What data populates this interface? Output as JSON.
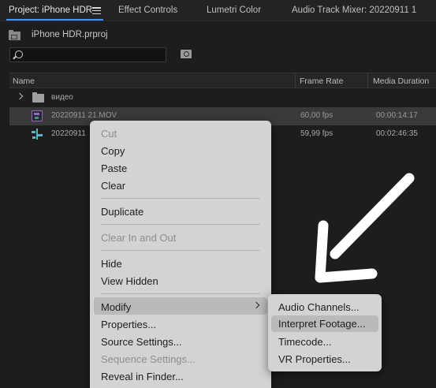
{
  "tabs": {
    "project": "Project: iPhone HDR",
    "effect_controls": "Effect Controls",
    "lumetri_color": "Lumetri Color",
    "audio_mixer": "Audio Track Mixer: 20220911 1"
  },
  "project_file": "iPhone HDR.prproj",
  "search": {
    "value": "",
    "placeholder": ""
  },
  "columns": {
    "name": "Name",
    "frame_rate": "Frame Rate",
    "media_duration": "Media Duration"
  },
  "rows": [
    {
      "name": "видео",
      "type": "folder",
      "frame_rate": "",
      "media_duration": ""
    },
    {
      "name": "20220911 21.MOV",
      "type": "clip",
      "frame_rate": "60,00 fps",
      "media_duration": "00:00:14:17",
      "selected": true
    },
    {
      "name": "20220911",
      "type": "sequence",
      "frame_rate": "59,99 fps",
      "media_duration": "00:02:46:35"
    }
  ],
  "context_menu": {
    "cut": "Cut",
    "copy": "Copy",
    "paste": "Paste",
    "clear": "Clear",
    "duplicate": "Duplicate",
    "clear_in_out": "Clear In and Out",
    "hide": "Hide",
    "view_hidden": "View Hidden",
    "modify": "Modify",
    "properties": "Properties...",
    "source_settings": "Source Settings...",
    "sequence_settings": "Sequence Settings...",
    "reveal_in_finder": "Reveal in Finder..."
  },
  "submenu": {
    "audio_channels": "Audio Channels...",
    "interpret_footage": "Interpret Footage...",
    "timecode": "Timecode...",
    "vr_properties": "VR Properties..."
  },
  "colors": {
    "accent": "#4a8ef0",
    "menu_bg": "#d2d4d2",
    "menu_highlight": "#b9bbb9",
    "panel_bg": "#1d1d1d",
    "annotation_arrow": "#ffffff"
  }
}
